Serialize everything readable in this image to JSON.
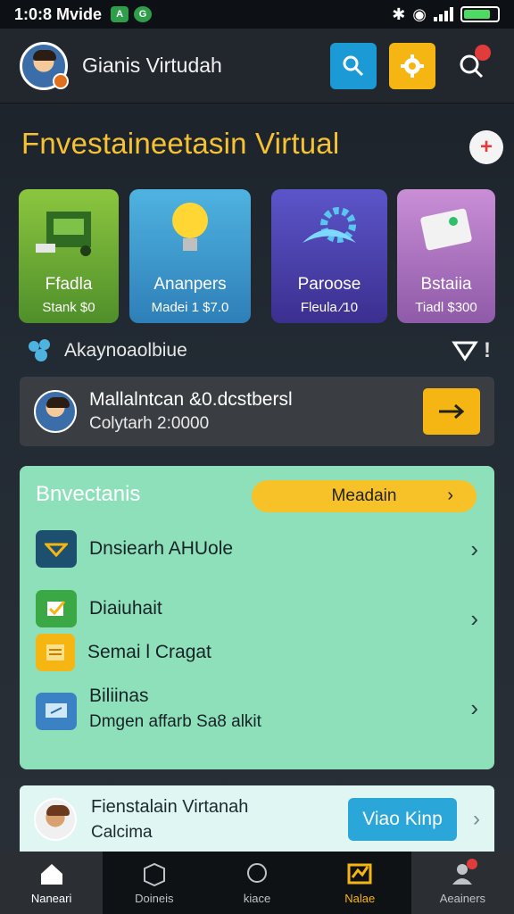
{
  "status_bar": {
    "time_text": "1:0:8 Mvide",
    "badge1": "A",
    "badge2": "G"
  },
  "header": {
    "username": "Gianis Virtudah"
  },
  "title": "Fnvestaineetasin Virtual",
  "fab_label": "+",
  "cards": [
    {
      "name": "Ffadla",
      "price": "Stank $0"
    },
    {
      "name": "Ananpers",
      "price": "Madei 1 $7.0"
    },
    {
      "name": "Paroose",
      "price": "Fleula ⁄10"
    },
    {
      "name": "Bstaiia",
      "price": "Tiadl $300"
    }
  ],
  "filter": {
    "label": "Akaynoaolbiue"
  },
  "banner": {
    "line1": "Mallalntcan &0.dcstbersl",
    "line2": "Colytarh 2:0000"
  },
  "panel": {
    "title": "Bnvectanis",
    "pill_label": "Meadain",
    "rows": [
      {
        "label": "Dnsiearh AHUole"
      },
      {
        "label": "Diaiuhait"
      },
      {
        "label": "Semai l Cragat"
      },
      {
        "label": "Biliinas",
        "sub": "Dmgen affarb Sa8 alkit"
      }
    ]
  },
  "lower": {
    "line1": "Fienstalain Virtanah",
    "line2": "Calcima",
    "cta": "Viao Kinp"
  },
  "nav": [
    {
      "label": "Naneari"
    },
    {
      "label": "Doineis"
    },
    {
      "label": "kiace"
    },
    {
      "label": "Nalae"
    },
    {
      "label": "Aeainers"
    }
  ],
  "colors": {
    "accent_yellow": "#f5b614",
    "accent_blue": "#1b9ad6",
    "panel_green": "#8ee0bb"
  }
}
